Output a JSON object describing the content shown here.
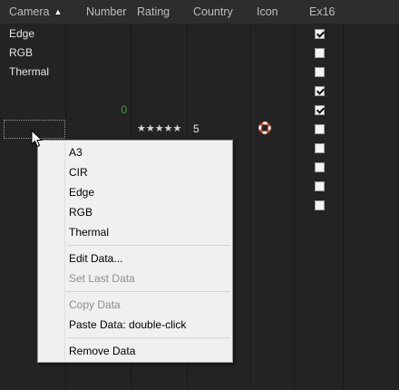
{
  "header": {
    "columns": {
      "camera": "Camera",
      "number": "Number",
      "rating": "Rating",
      "country": "Country",
      "icon": "Icon",
      "ex16": "Ex16"
    },
    "sort_indicator": "chevron-up-icon"
  },
  "rows": [
    {
      "camera": "Edge",
      "ex16": true
    },
    {
      "camera": "RGB",
      "ex16": false
    },
    {
      "camera": "Thermal",
      "ex16": false
    },
    {
      "camera": "",
      "ex16": true
    },
    {
      "camera": "",
      "number": "0",
      "ex16": true
    },
    {
      "camera": "",
      "rating_stars": "★★★★★",
      "country": "5",
      "icon": "lifebuoy-icon",
      "ex16": false
    },
    {
      "camera": "",
      "ex16": false
    },
    {
      "camera": "",
      "ex16": false
    },
    {
      "camera": "",
      "ex16": false
    },
    {
      "camera": "",
      "ex16": false
    }
  ],
  "context_menu": {
    "options": [
      "A3",
      "CIR",
      "Edge",
      "RGB",
      "Thermal"
    ],
    "edit_data": "Edit Data...",
    "set_last_data": "Set Last Data",
    "copy_data": "Copy Data",
    "paste_data": "Paste Data: double-click",
    "remove_data": "Remove Data"
  },
  "colors": {
    "background": "#232323",
    "header": "#2d2d2d",
    "menu_background": "#f0f0f0",
    "number_accent": "#3aa23a"
  }
}
